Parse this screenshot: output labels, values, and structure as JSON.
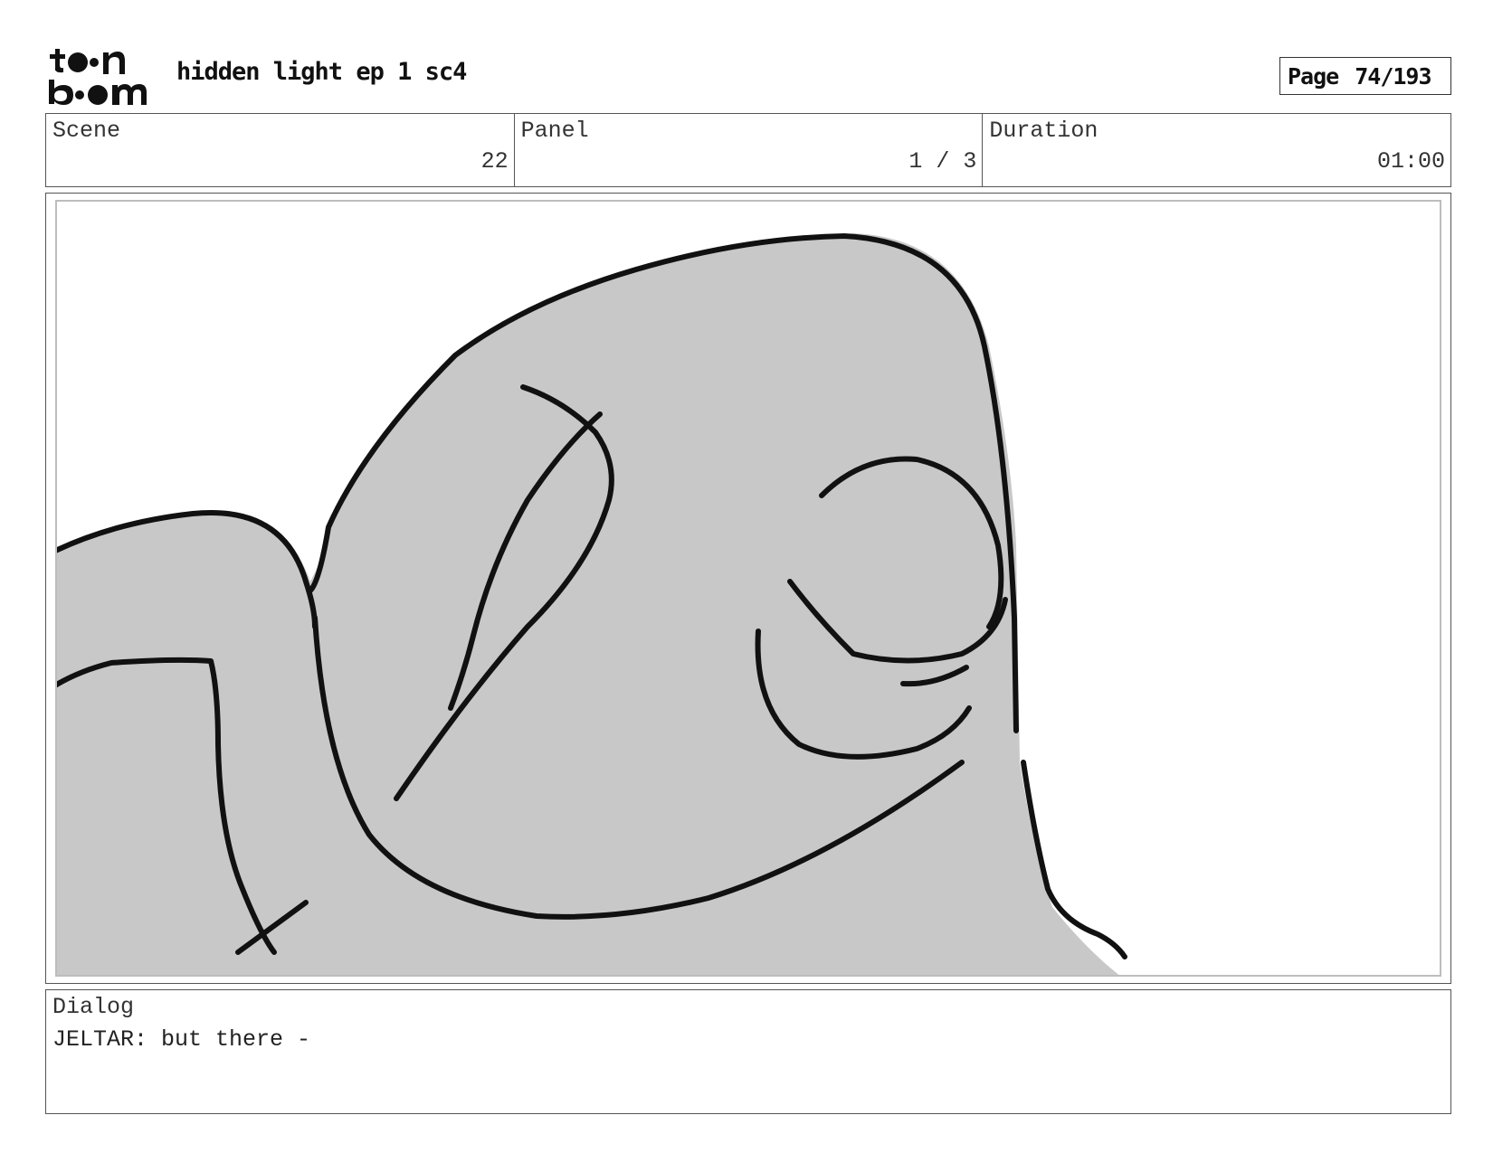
{
  "header": {
    "logo_text": "toon boom",
    "title": "hidden light ep 1 sc4",
    "page_label": "Page",
    "page_value": "74/193"
  },
  "info": {
    "scene_label": "Scene",
    "scene_value": "22",
    "panel_label": "Panel",
    "panel_value": "1 / 3",
    "duration_label": "Duration",
    "duration_value": "01:00"
  },
  "panel": {
    "image_icon": "storyboard-sketch",
    "fill_color": "#c8c8c8",
    "line_color": "#111111"
  },
  "dialog": {
    "label": "Dialog",
    "text": "JELTAR: but there -"
  }
}
